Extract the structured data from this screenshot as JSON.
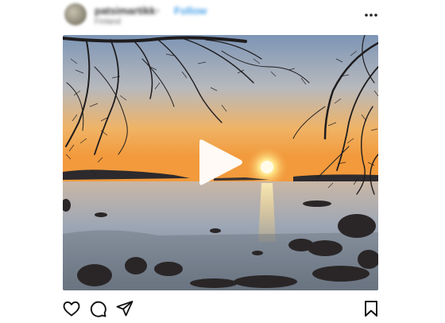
{
  "post": {
    "username": "patsimartikk",
    "separator": "•",
    "follow_label": "Follow",
    "location": "Finland",
    "more_label": "•••"
  },
  "media": {
    "type": "video",
    "description_icon": "play-icon"
  },
  "actions": {
    "like_icon": "heart-icon",
    "comment_icon": "comment-icon",
    "share_icon": "send-icon",
    "save_icon": "bookmark-icon"
  },
  "colors": {
    "follow": "#4aa3ea",
    "sky_top": "#8fa9c8",
    "sky_bottom": "#f2a24a",
    "sun": "#fff4c0",
    "water": "#a9b3c3"
  }
}
